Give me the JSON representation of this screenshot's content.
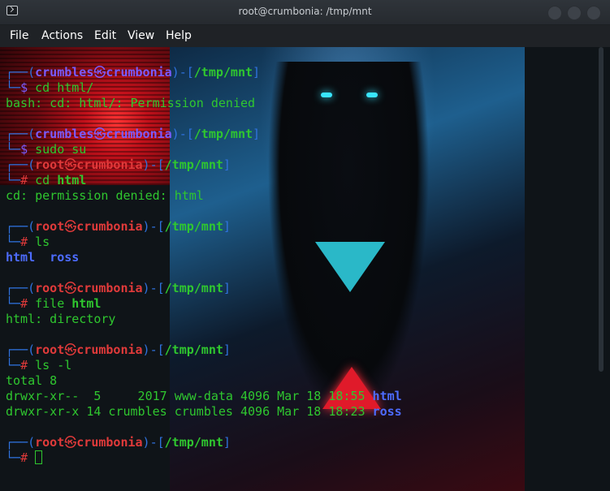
{
  "window": {
    "title": "root@crumbonia: /tmp/mnt"
  },
  "menu": {
    "items": [
      "File",
      "Actions",
      "Edit",
      "View",
      "Help"
    ]
  },
  "prompt": {
    "frame_open": "┌──(",
    "frame_mid": ")-[",
    "frame_close": "]",
    "frame_bottom": "└─",
    "symbol": "㉿",
    "host": "crumbonia",
    "path": "/tmp/mnt",
    "user_kali": "crumbles",
    "user_root": "root",
    "dollar": "$ ",
    "hash": "# "
  },
  "session": {
    "cmd1": "cd html/",
    "out1": "bash: cd: html/: Permission denied",
    "cmd2": "sudo su",
    "cmd3_prefix": "cd ",
    "cmd3_arg": "html",
    "out3": "cd: permission denied: html",
    "cmd4": "ls",
    "out4_a": "html",
    "out4_sep": "  ",
    "out4_b": "ross",
    "cmd5_prefix": "file ",
    "cmd5_arg": "html",
    "out5": "html: directory",
    "cmd6": "ls -l",
    "out6_total": "total 8",
    "out6_row1": "drwxr-xr--  5     2017 www-data 4096 Mar 18 18:55 ",
    "out6_row1_name": "html",
    "out6_row2": "drwxr-xr-x 14 crumbles crumbles 4096 Mar 18 18:23 ",
    "out6_row2_name": "ross"
  },
  "colors": {
    "titlebar": "#2f343a",
    "terminal_bg": "#0f1418",
    "prompt_frame": "#2f73e0",
    "root_user": "#e03a3a",
    "kali_user": "#7a5cff",
    "text_green": "#2fc72f",
    "dir_blue": "#4d6cff"
  }
}
